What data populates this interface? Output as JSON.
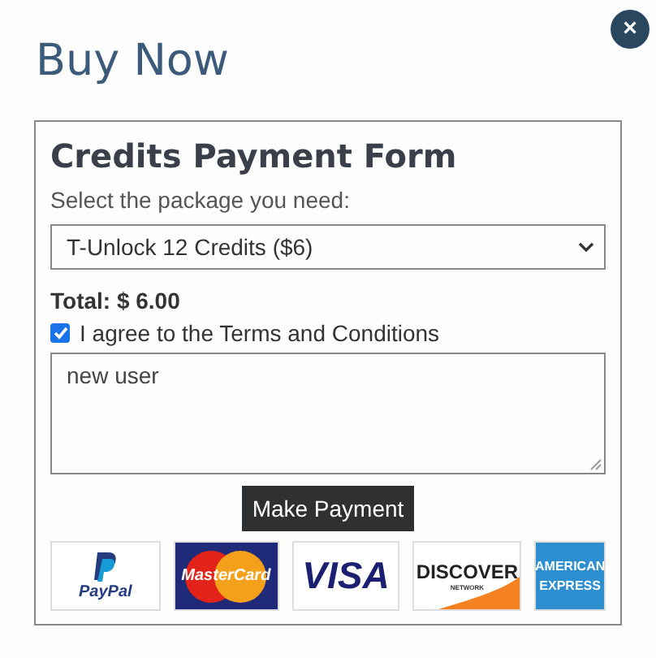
{
  "dialog": {
    "title": "Buy Now",
    "close": "×"
  },
  "form": {
    "heading": "Credits Payment Form",
    "package_label": "Select the package you need:",
    "package_value": "T-Unlock 12 Credits ($6)",
    "total": "Total: $ 6.00",
    "agree": {
      "label": "I agree to the Terms and Conditions",
      "checked": true
    },
    "note": "new user",
    "submit": "Make Payment"
  },
  "payment_methods": [
    {
      "kind": "paypal",
      "text": "PayPal"
    },
    {
      "kind": "mastercard",
      "text": "MasterCard"
    },
    {
      "kind": "visa",
      "text": "VISA"
    },
    {
      "kind": "discover",
      "text": "DISCOVER",
      "sub": "NETWORK"
    },
    {
      "kind": "amex",
      "text": "AMERICAN",
      "sub": "EXPRESS"
    }
  ]
}
